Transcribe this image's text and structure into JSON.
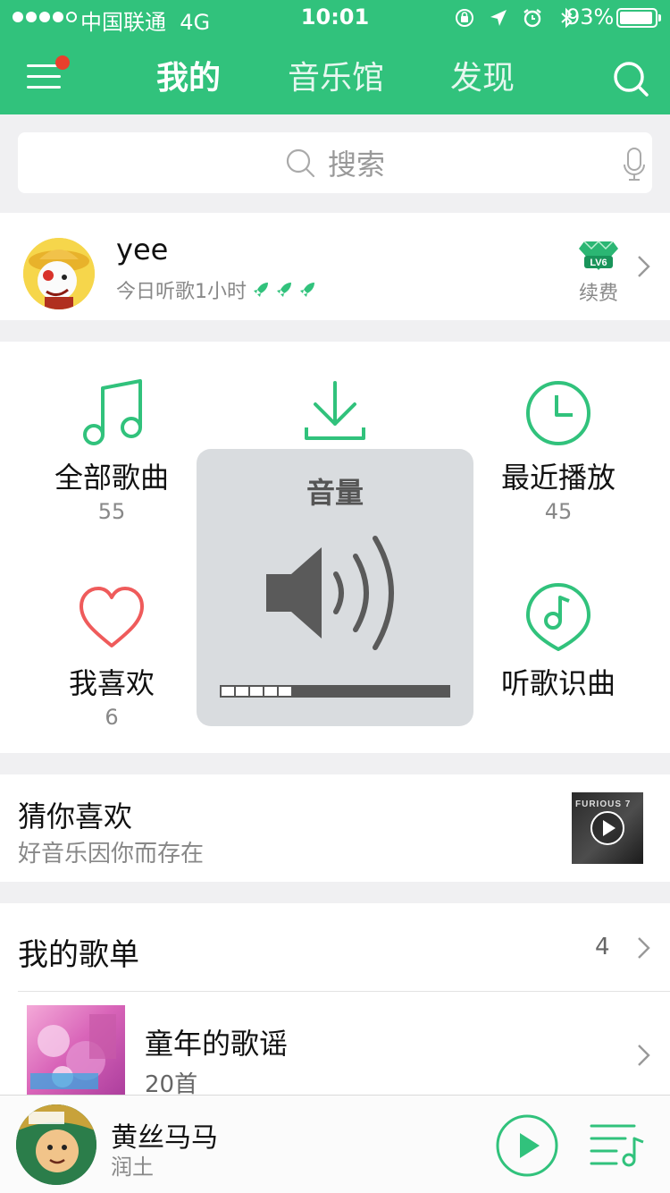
{
  "status_bar": {
    "carrier": "中国联通",
    "network": "4G",
    "time": "10:01",
    "battery": "93%"
  },
  "nav": {
    "tabs": [
      "我的",
      "音乐馆",
      "发现"
    ],
    "active_tab": 0
  },
  "search": {
    "placeholder": "搜索"
  },
  "user": {
    "name": "yee",
    "listen_today": "今日听歌1小时",
    "vip_level": "LV6",
    "renew_label": "续费"
  },
  "grid": {
    "all_songs": {
      "label": "全部歌曲",
      "count": "55"
    },
    "recent": {
      "label": "最近播放",
      "count": "45"
    },
    "favorites": {
      "label": "我喜欢",
      "count": "6"
    },
    "recognize": {
      "label": "听歌识曲"
    }
  },
  "volume_hud": {
    "title": "音量",
    "level_fraction": 0.31
  },
  "recommend": {
    "title": "猜你喜欢",
    "subtitle": "好音乐因你而存在",
    "thumb_text": "FURIOUS 7"
  },
  "playlists": {
    "title": "我的歌单",
    "count": "4",
    "items": [
      {
        "name": "童年的歌谣",
        "songs": "20首"
      }
    ]
  },
  "player": {
    "song": "黄丝马马",
    "artist": "润土"
  },
  "colors": {
    "brand_green": "#31c27c",
    "heart_red": "#ef5b5b"
  }
}
